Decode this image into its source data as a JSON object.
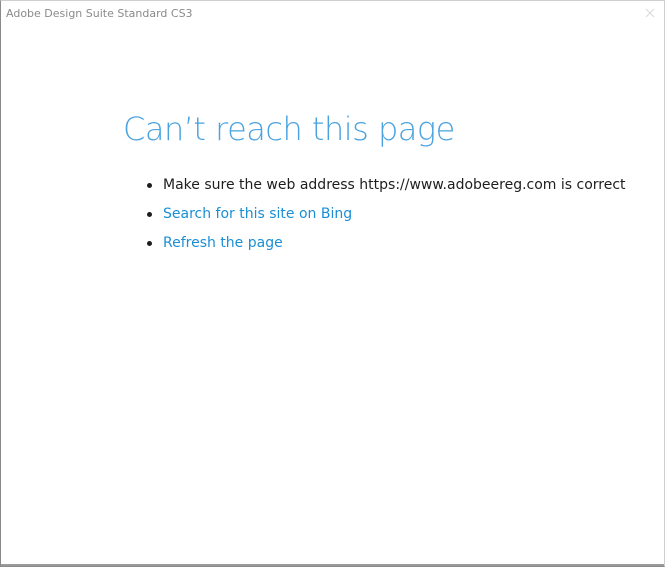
{
  "window": {
    "title": "Adobe Design Suite Standard CS3",
    "close_icon": "close-icon"
  },
  "error": {
    "heading": "Can’t reach this page",
    "suggestions": {
      "address_text": "Make sure the web address https://www.adobeereg.com is correct",
      "search_link": "Search for this site on Bing",
      "refresh_link": "Refresh the page"
    }
  },
  "colors": {
    "heading": "#4aa3df",
    "link": "#1a8fd4",
    "text": "#1e1e1e",
    "title": "#8a8a8a"
  }
}
